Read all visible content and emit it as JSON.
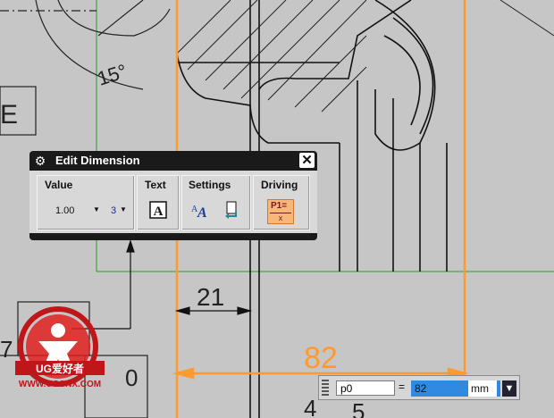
{
  "canvas": {
    "angle_annotation": "15°",
    "edge_letter": "E",
    "dimension_small": "21",
    "dimension_main": "82",
    "bottom_digits": [
      "7",
      "0",
      "4",
      "5"
    ],
    "colors": {
      "background": "#c6c6c6",
      "highlight": "#ff9a2e",
      "datum": "#2a9a2a",
      "line": "#222222"
    }
  },
  "dialog": {
    "title": "Edit Dimension",
    "groups": {
      "value": {
        "label": "Value",
        "precision": "1.00",
        "decimals": "3"
      },
      "text": {
        "label": "Text",
        "icon": "text-A-icon"
      },
      "settings": {
        "label": "Settings",
        "icon": "settings-A-icon"
      },
      "driving": {
        "label": "Driving",
        "icon": "driving-p1-icon",
        "icon_text": "P1="
      }
    }
  },
  "input_bar": {
    "name_value": "p0",
    "equals": "=",
    "value": "82",
    "unit": "mm"
  },
  "watermark": {
    "brand": "UG爱好者",
    "url": "WWW.UGSNX.COM"
  }
}
